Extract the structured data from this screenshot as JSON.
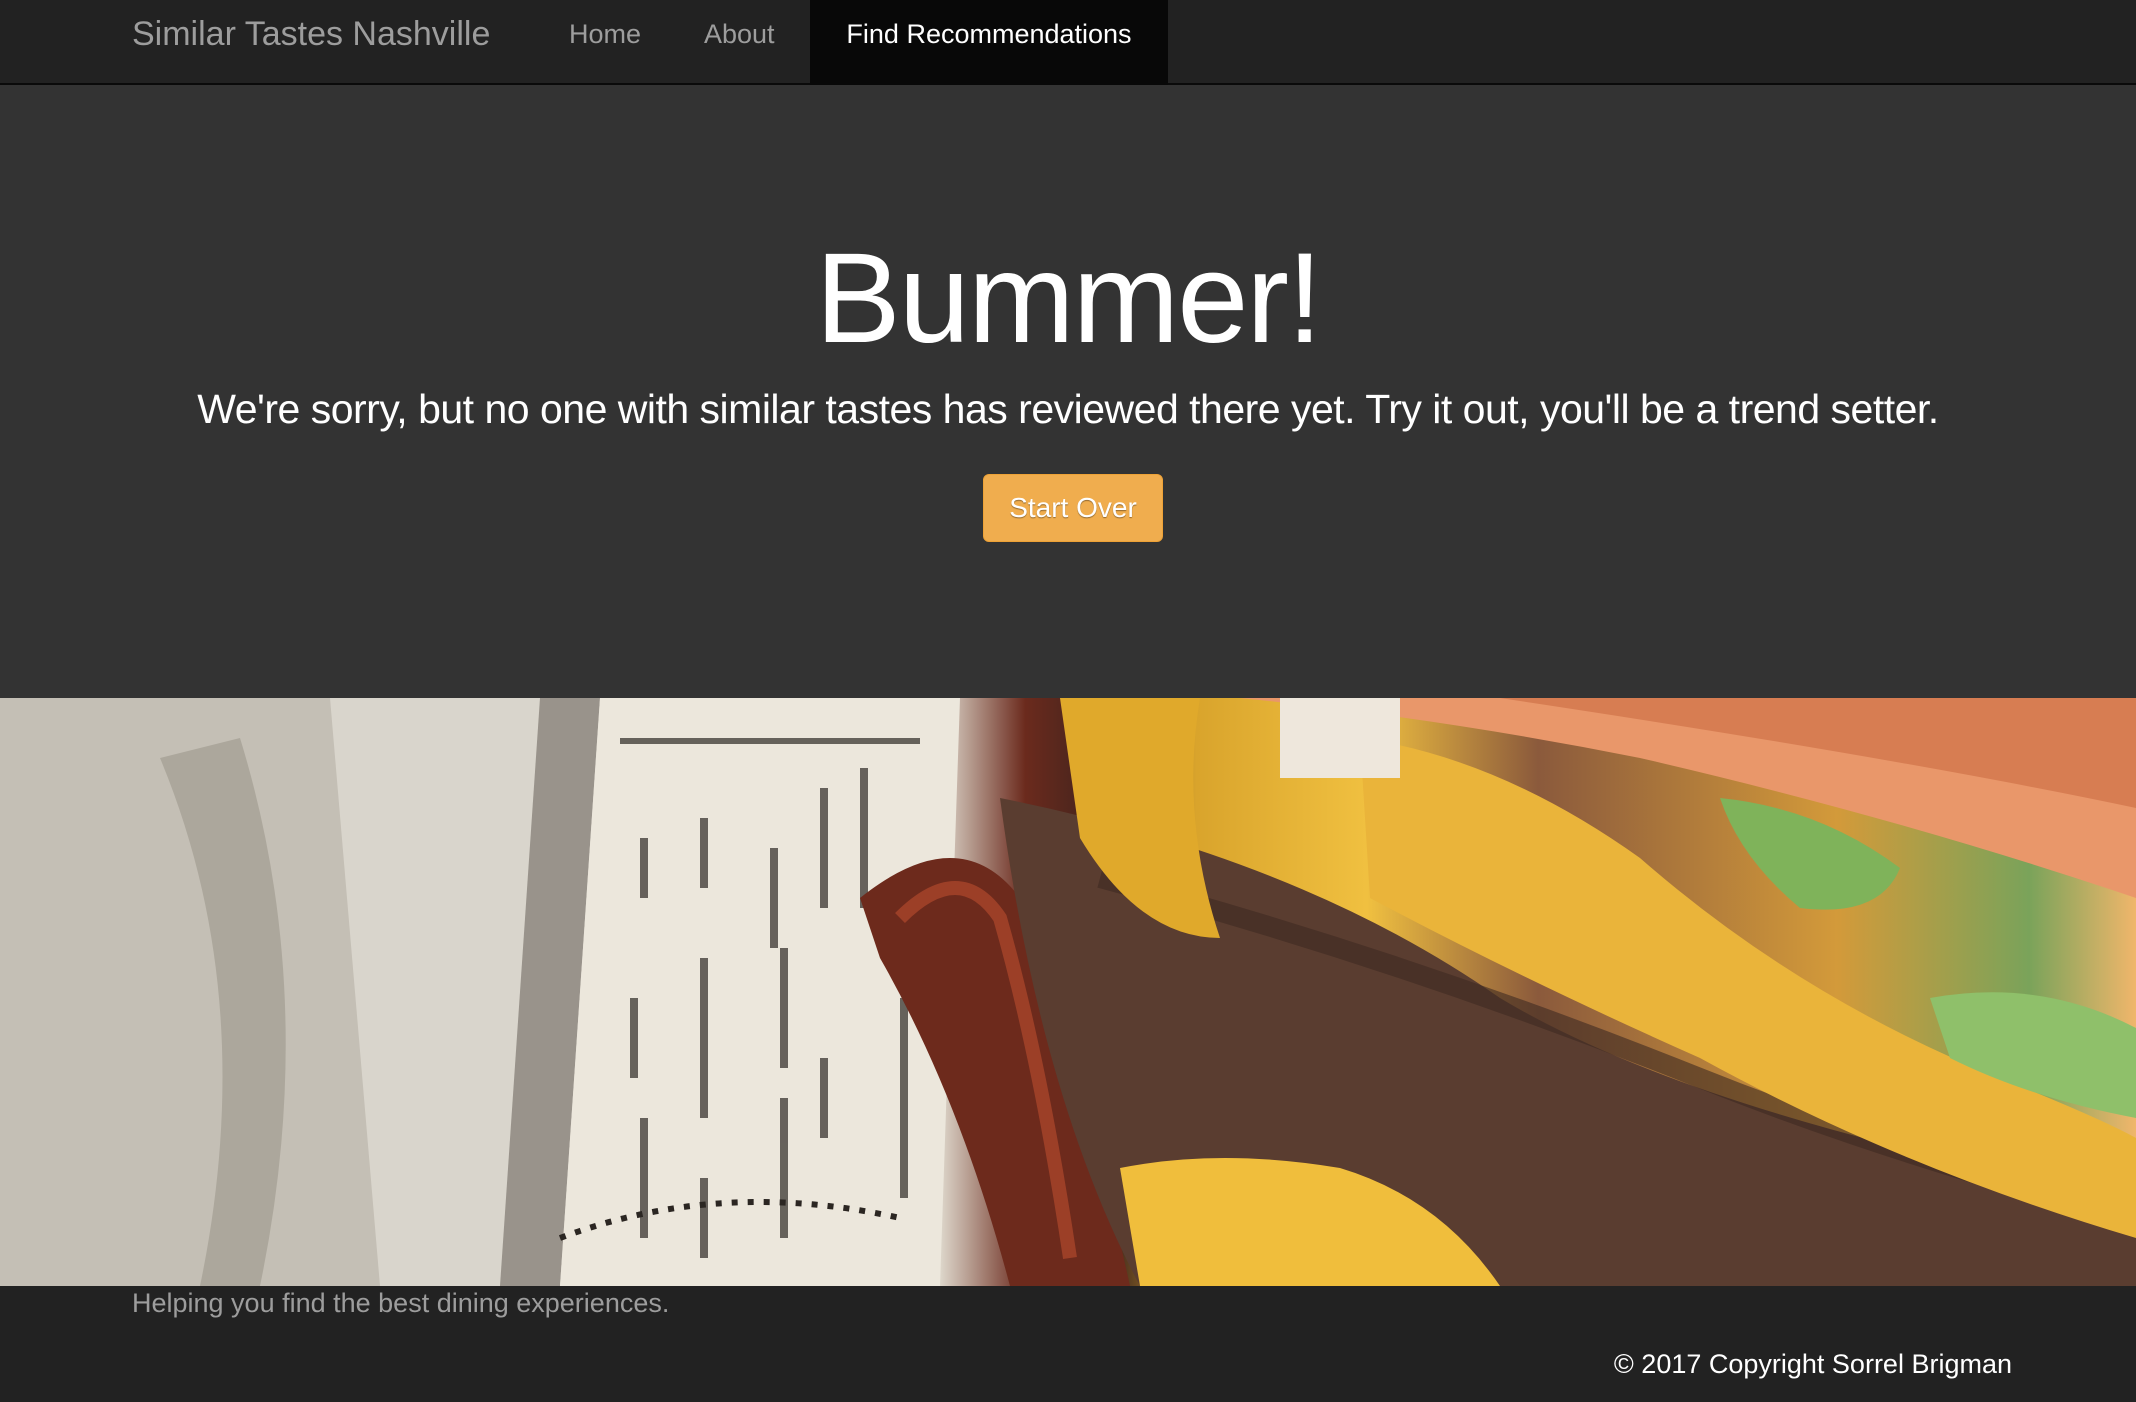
{
  "navbar": {
    "brand": "Similar Tastes Nashville",
    "items": [
      {
        "label": "Home"
      },
      {
        "label": "About"
      },
      {
        "label": "Find Recommendations",
        "active": true
      }
    ]
  },
  "hero": {
    "title": "Bummer!",
    "message": "We're sorry, but no one with similar tastes has reviewed there yet. Try it out, you'll be a trend setter.",
    "button_label": "Start Over",
    "button_color": "#f0ad4e"
  },
  "photo": {
    "subject": "burger-with-cheese-and-bacon"
  },
  "footer": {
    "tagline": "Helping you find the best dining experiences.",
    "copyright": "© 2017 Copyright Sorrel Brigman"
  },
  "colors": {
    "navbar_bg": "#222222",
    "hero_bg": "#333333",
    "accent": "#f0ad4e"
  }
}
